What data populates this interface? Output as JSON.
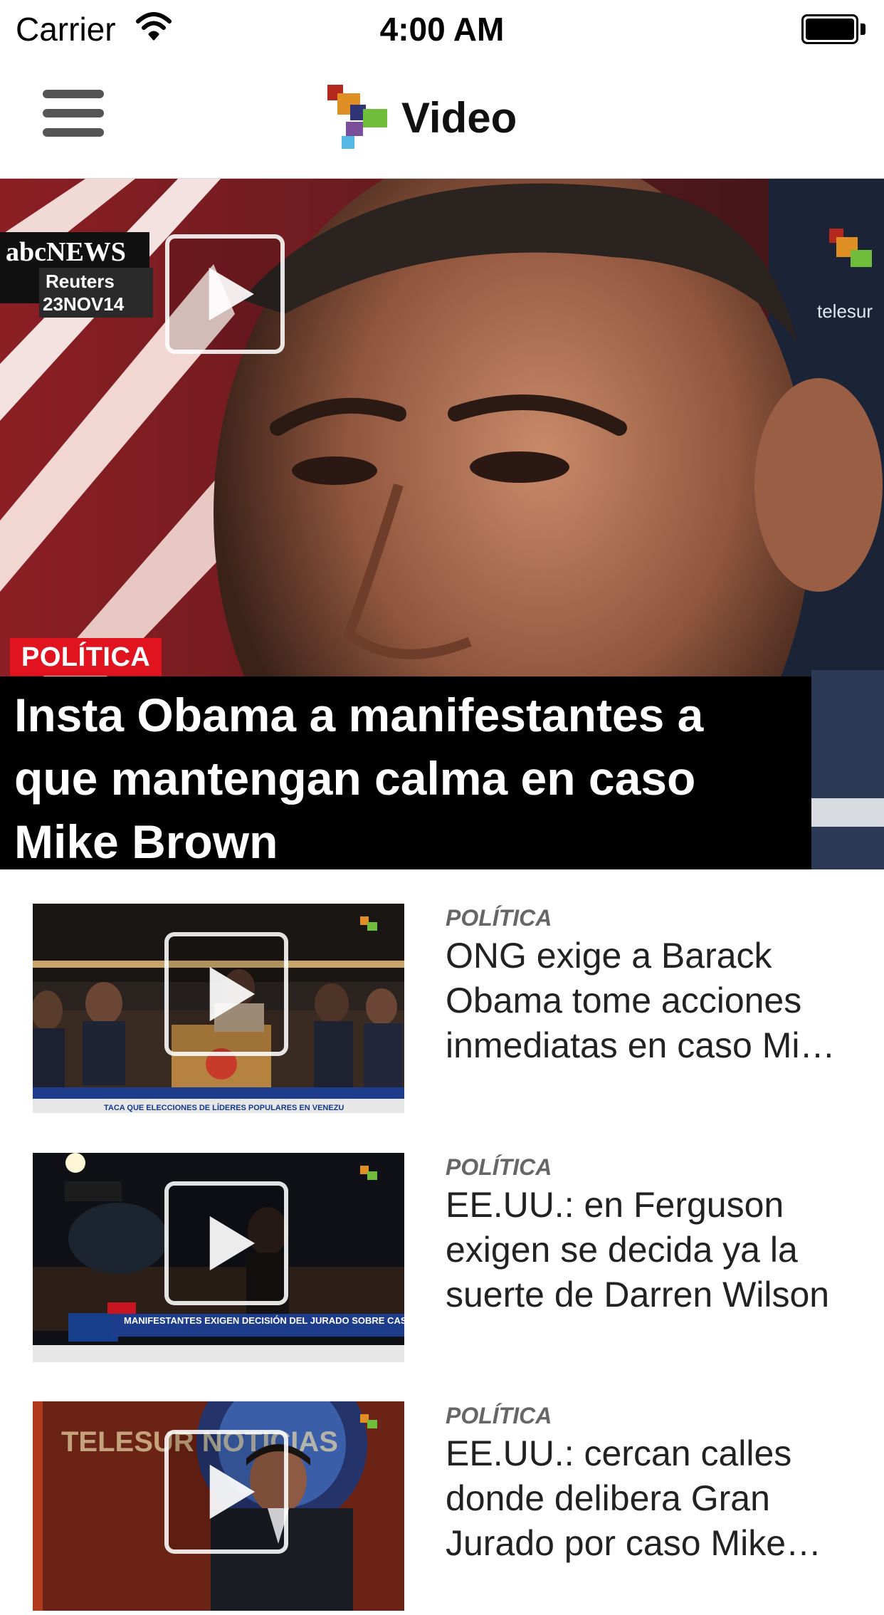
{
  "status_bar": {
    "carrier": "Carrier",
    "time": "4:00 AM"
  },
  "nav": {
    "title": "Video"
  },
  "hero": {
    "category": "POLÍTICA",
    "title": "Insta Obama a manifestantes a que mantengan calma en caso Mike Brown",
    "overlay": {
      "network": "abcNEWS",
      "agency": "Reuters",
      "date": "23NOV14",
      "watermark": "telesur"
    }
  },
  "items": [
    {
      "category": "POLÍTICA",
      "title": "ONG exige a Barack Obama tome acciones inmediatas en caso Mi…",
      "ticker": "TACA QUE ELECCIONES DE LÍDERES POPULARES EN VENEZU"
    },
    {
      "category": "POLÍTICA",
      "title": "EE.UU.: en Ferguson exigen se decida ya la suerte de Darren Wilson",
      "ticker": "MANIFESTANTES EXIGEN DECISIÓN DEL JURADO SOBRE CASO FERGUSON"
    },
    {
      "category": "POLÍTICA",
      "title": "EE.UU.: cercan calles donde delibera Gran Jurado por caso Mike…",
      "ticker": "TELESUR NOTICIAS"
    }
  ],
  "icons": [
    "wifi-icon",
    "battery-icon",
    "hamburger-menu-icon",
    "telesur-logo-icon",
    "play-icon"
  ],
  "colors": {
    "badge_red": "#e0131f",
    "caption_bg": "#000000",
    "category_gray": "#666666"
  }
}
